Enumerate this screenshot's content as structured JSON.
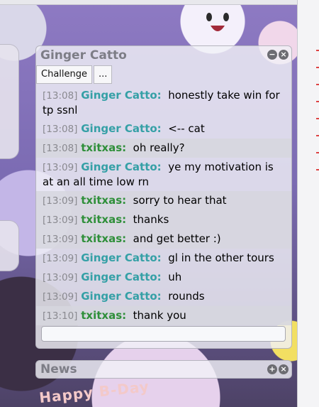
{
  "chat_panel": {
    "title": "Ginger Catto",
    "minimize_icon": "minus-circle-icon",
    "close_icon": "close-circle-icon",
    "toolbar": {
      "challenge_label": "Challenge",
      "more_label": "..."
    },
    "messages": [
      {
        "time": "[13:08]",
        "user": "Ginger Catto:",
        "text": "honestly take win for tp ssnl",
        "user_color": "#35a0a6"
      },
      {
        "time": "[13:08]",
        "user": "Ginger Catto:",
        "text": "<-- cat",
        "user_color": "#35a0a6"
      },
      {
        "time": "[13:08]",
        "user": "txitxas:",
        "text": "oh really?",
        "user_color": "#2f8f3a"
      },
      {
        "time": "[13:09]",
        "user": "Ginger Catto:",
        "text": "ye my motivation is at an all time low rn",
        "user_color": "#35a0a6"
      },
      {
        "time": "[13:09]",
        "user": "txitxas:",
        "text": "sorry to hear that",
        "user_color": "#2f8f3a"
      },
      {
        "time": "[13:09]",
        "user": "txitxas:",
        "text": "thanks",
        "user_color": "#2f8f3a"
      },
      {
        "time": "[13:09]",
        "user": "txitxas:",
        "text": "and get better :)",
        "user_color": "#2f8f3a"
      },
      {
        "time": "[13:09]",
        "user": "Ginger Catto:",
        "text": "gl in the other tours",
        "user_color": "#35a0a6"
      },
      {
        "time": "[13:09]",
        "user": "Ginger Catto:",
        "text": "uh",
        "user_color": "#35a0a6"
      },
      {
        "time": "[13:09]",
        "user": "Ginger Catto:",
        "text": "rounds",
        "user_color": "#35a0a6"
      },
      {
        "time": "[13:10]",
        "user": "txitxas:",
        "text": "thank you",
        "user_color": "#2f8f3a"
      }
    ],
    "input_placeholder": ""
  },
  "news_panel": {
    "title": "News",
    "expand_icon": "plus-circle-icon",
    "close_icon": "close-circle-icon"
  },
  "background": {
    "banner_text": "Happy B-Day"
  }
}
